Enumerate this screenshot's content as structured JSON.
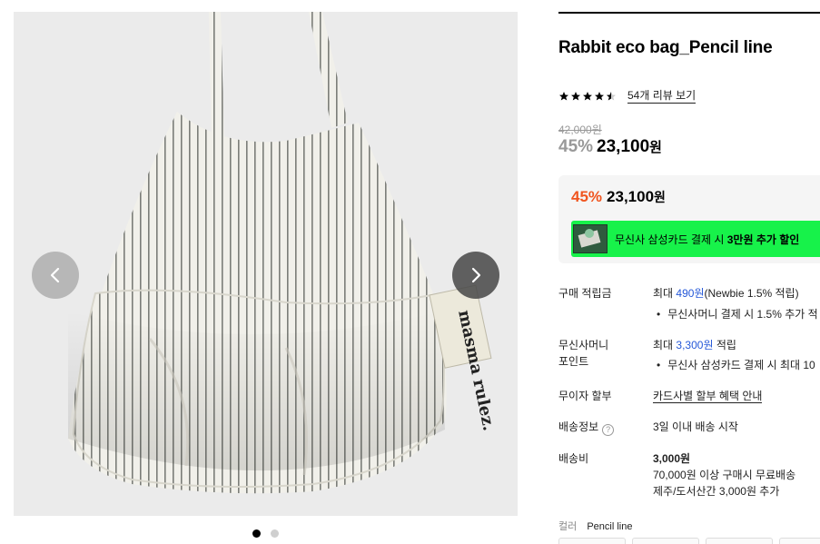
{
  "gallery": {
    "brand_tag_text": "masma rulez.",
    "dots": [
      {
        "active": true
      },
      {
        "active": false
      }
    ]
  },
  "product": {
    "title": "Rabbit eco bag_Pencil line",
    "rating": 4.5,
    "review_link": "54개 리뷰 보기",
    "original_price": "42,000원",
    "discount_pct": "45%",
    "sale_price": "23,100",
    "won": "원"
  },
  "price_box": {
    "discount_pct": "45%",
    "sale_price": "23,100",
    "won": "원",
    "banner_text_pre": "무신사 삼성카드 결제 시 ",
    "banner_text_bold": "3만원 추가 할인"
  },
  "details": {
    "points_label": "구매 적립금",
    "points_pre": "최대 ",
    "points_amount": "490원",
    "points_post": "(Newbie 1.5% 적립)",
    "points_bullet": "무신사머니 결제 시 1.5% 추가 적",
    "money_label_1": "무신사머니",
    "money_label_2": "포인트",
    "money_pre": "최대 ",
    "money_amount": "3,300원",
    "money_post": " 적립",
    "money_bullet": "무신사 삼성카드 결제 시 최대 10",
    "installment_label": "무이자 할부",
    "installment_link": "카드사별 할부 혜택 안내",
    "shipping_label": "배송정보",
    "shipping_help": "?",
    "shipping_value": "3일 이내 배송 시작",
    "fee_label": "배송비",
    "fee_value": "3,000원",
    "fee_line2": "70,000원 이상 구매시 무료배송",
    "fee_line3": "제주/도서산간 3,000원 추가"
  },
  "color": {
    "label": "컬러",
    "value": "Pencil line"
  },
  "colors": {
    "sale_red": "#f0541e",
    "link_blue": "#2558d8",
    "banner_green": "#17f24a"
  }
}
